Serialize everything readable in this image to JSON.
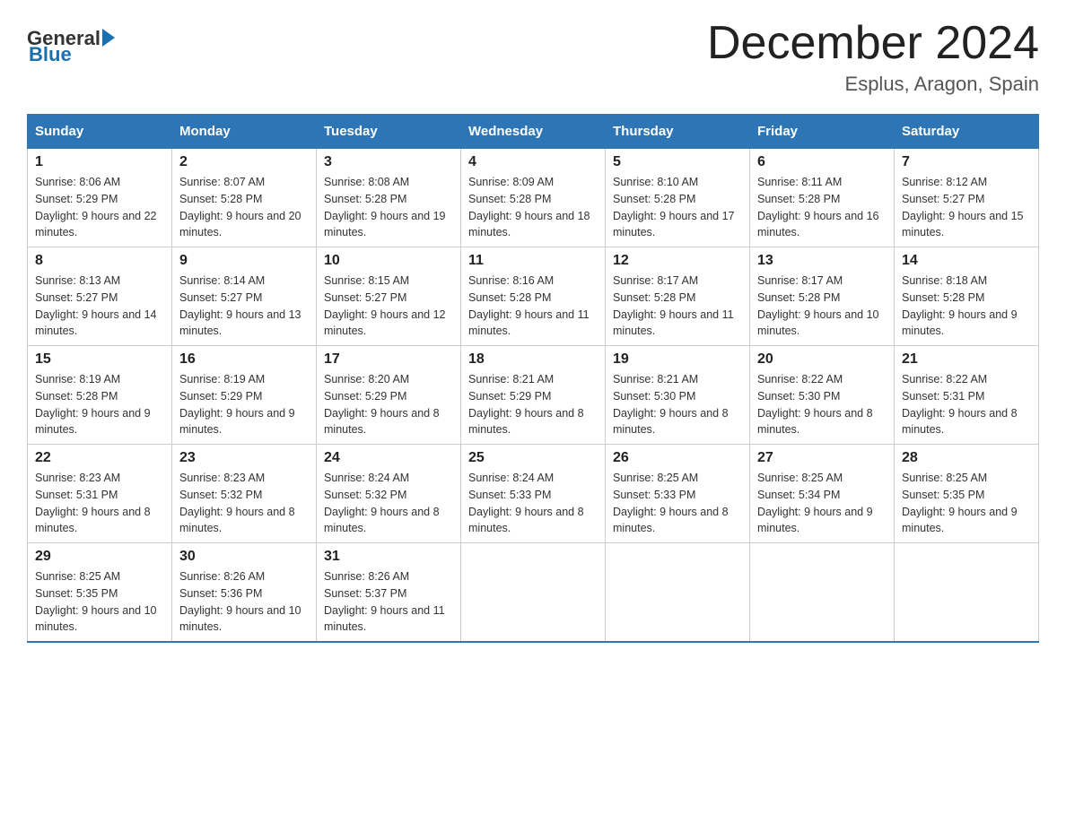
{
  "header": {
    "logo_text_general": "General",
    "logo_text_blue": "Blue",
    "month_title": "December 2024",
    "location": "Esplus, Aragon, Spain"
  },
  "days_of_week": [
    "Sunday",
    "Monday",
    "Tuesday",
    "Wednesday",
    "Thursday",
    "Friday",
    "Saturday"
  ],
  "weeks": [
    [
      {
        "day": "1",
        "sunrise": "8:06 AM",
        "sunset": "5:29 PM",
        "daylight": "9 hours and 22 minutes."
      },
      {
        "day": "2",
        "sunrise": "8:07 AM",
        "sunset": "5:28 PM",
        "daylight": "9 hours and 20 minutes."
      },
      {
        "day": "3",
        "sunrise": "8:08 AM",
        "sunset": "5:28 PM",
        "daylight": "9 hours and 19 minutes."
      },
      {
        "day": "4",
        "sunrise": "8:09 AM",
        "sunset": "5:28 PM",
        "daylight": "9 hours and 18 minutes."
      },
      {
        "day": "5",
        "sunrise": "8:10 AM",
        "sunset": "5:28 PM",
        "daylight": "9 hours and 17 minutes."
      },
      {
        "day": "6",
        "sunrise": "8:11 AM",
        "sunset": "5:28 PM",
        "daylight": "9 hours and 16 minutes."
      },
      {
        "day": "7",
        "sunrise": "8:12 AM",
        "sunset": "5:27 PM",
        "daylight": "9 hours and 15 minutes."
      }
    ],
    [
      {
        "day": "8",
        "sunrise": "8:13 AM",
        "sunset": "5:27 PM",
        "daylight": "9 hours and 14 minutes."
      },
      {
        "day": "9",
        "sunrise": "8:14 AM",
        "sunset": "5:27 PM",
        "daylight": "9 hours and 13 minutes."
      },
      {
        "day": "10",
        "sunrise": "8:15 AM",
        "sunset": "5:27 PM",
        "daylight": "9 hours and 12 minutes."
      },
      {
        "day": "11",
        "sunrise": "8:16 AM",
        "sunset": "5:28 PM",
        "daylight": "9 hours and 11 minutes."
      },
      {
        "day": "12",
        "sunrise": "8:17 AM",
        "sunset": "5:28 PM",
        "daylight": "9 hours and 11 minutes."
      },
      {
        "day": "13",
        "sunrise": "8:17 AM",
        "sunset": "5:28 PM",
        "daylight": "9 hours and 10 minutes."
      },
      {
        "day": "14",
        "sunrise": "8:18 AM",
        "sunset": "5:28 PM",
        "daylight": "9 hours and 9 minutes."
      }
    ],
    [
      {
        "day": "15",
        "sunrise": "8:19 AM",
        "sunset": "5:28 PM",
        "daylight": "9 hours and 9 minutes."
      },
      {
        "day": "16",
        "sunrise": "8:19 AM",
        "sunset": "5:29 PM",
        "daylight": "9 hours and 9 minutes."
      },
      {
        "day": "17",
        "sunrise": "8:20 AM",
        "sunset": "5:29 PM",
        "daylight": "9 hours and 8 minutes."
      },
      {
        "day": "18",
        "sunrise": "8:21 AM",
        "sunset": "5:29 PM",
        "daylight": "9 hours and 8 minutes."
      },
      {
        "day": "19",
        "sunrise": "8:21 AM",
        "sunset": "5:30 PM",
        "daylight": "9 hours and 8 minutes."
      },
      {
        "day": "20",
        "sunrise": "8:22 AM",
        "sunset": "5:30 PM",
        "daylight": "9 hours and 8 minutes."
      },
      {
        "day": "21",
        "sunrise": "8:22 AM",
        "sunset": "5:31 PM",
        "daylight": "9 hours and 8 minutes."
      }
    ],
    [
      {
        "day": "22",
        "sunrise": "8:23 AM",
        "sunset": "5:31 PM",
        "daylight": "9 hours and 8 minutes."
      },
      {
        "day": "23",
        "sunrise": "8:23 AM",
        "sunset": "5:32 PM",
        "daylight": "9 hours and 8 minutes."
      },
      {
        "day": "24",
        "sunrise": "8:24 AM",
        "sunset": "5:32 PM",
        "daylight": "9 hours and 8 minutes."
      },
      {
        "day": "25",
        "sunrise": "8:24 AM",
        "sunset": "5:33 PM",
        "daylight": "9 hours and 8 minutes."
      },
      {
        "day": "26",
        "sunrise": "8:25 AM",
        "sunset": "5:33 PM",
        "daylight": "9 hours and 8 minutes."
      },
      {
        "day": "27",
        "sunrise": "8:25 AM",
        "sunset": "5:34 PM",
        "daylight": "9 hours and 9 minutes."
      },
      {
        "day": "28",
        "sunrise": "8:25 AM",
        "sunset": "5:35 PM",
        "daylight": "9 hours and 9 minutes."
      }
    ],
    [
      {
        "day": "29",
        "sunrise": "8:25 AM",
        "sunset": "5:35 PM",
        "daylight": "9 hours and 10 minutes."
      },
      {
        "day": "30",
        "sunrise": "8:26 AM",
        "sunset": "5:36 PM",
        "daylight": "9 hours and 10 minutes."
      },
      {
        "day": "31",
        "sunrise": "8:26 AM",
        "sunset": "5:37 PM",
        "daylight": "9 hours and 11 minutes."
      },
      null,
      null,
      null,
      null
    ]
  ]
}
